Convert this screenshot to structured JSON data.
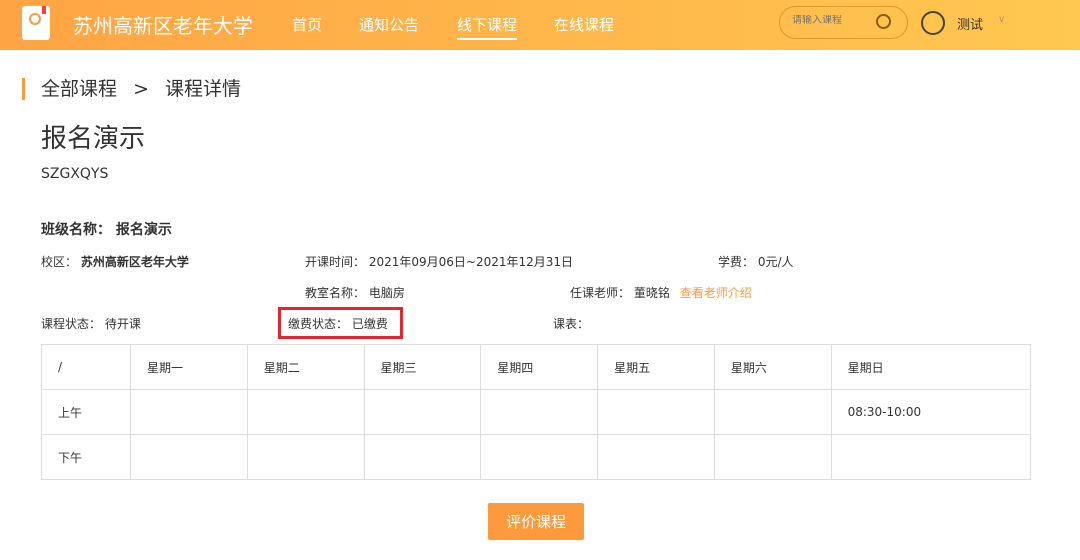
{
  "header": {
    "title": "苏州高新区老年大学",
    "nav": [
      "首页",
      "通知公告",
      "线下课程",
      "在线课程"
    ],
    "active_nav": 2,
    "search_placeholder": "请输入课程",
    "user": "测试"
  },
  "breadcrumb": {
    "root": "全部课程",
    "sep": ">",
    "current": "课程详情"
  },
  "course": {
    "name": "报名演示",
    "code": "SZGXQYS",
    "class_label": "班级名称：",
    "class_name": "报名演示"
  },
  "info": {
    "campus_label": "校区：",
    "campus": "苏州高新区老年大学",
    "time_label": "开课时间：",
    "time": "2021年09月06日~2021年12月31日",
    "fee_label": "学费：",
    "fee": "0元/人",
    "room_label": "教室名称：",
    "room": "电脑房",
    "teacher_label": "任课老师：",
    "teacher": "董晓铭",
    "teacher_link": "查看老师介绍",
    "status_label": "课程状态：",
    "status": "待开课",
    "pay_label": "缴费状态：",
    "pay": "已缴费",
    "schedule_label": "课表："
  },
  "schedule": {
    "headers": [
      "/",
      "星期一",
      "星期二",
      "星期三",
      "星期四",
      "星期五",
      "星期六",
      "星期日"
    ],
    "rows": [
      [
        "上午",
        "",
        "",
        "",
        "",
        "",
        "",
        "08:30-10:00"
      ],
      [
        "下午",
        "",
        "",
        "",
        "",
        "",
        "",
        ""
      ]
    ]
  },
  "button": "评价课程"
}
